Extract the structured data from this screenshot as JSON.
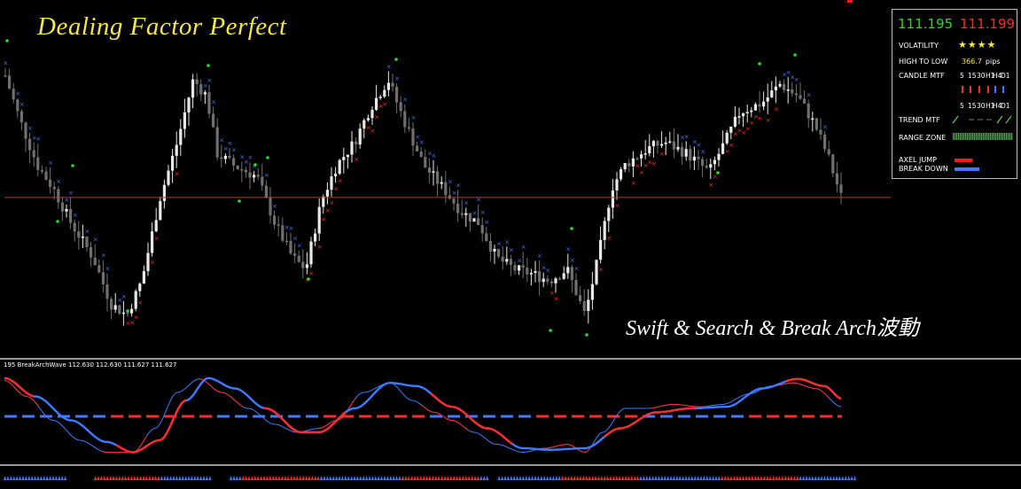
{
  "title": "Dealing Factor Perfect",
  "subtitle": "Swift & Search & Break Arch波動",
  "indicator_label": "195  BreakArchWave 112.630 112.630 111.627 111.627",
  "panel": {
    "bid": "111.195",
    "ask": "111.199",
    "volatility_label": "VOLATILITY",
    "volatility_stars": "★★★★",
    "high_low_label": "HIGH TO LOW",
    "high_low_value": "366.7",
    "high_low_unit": "pips",
    "candle_mtf_label": "CANDLE MTF",
    "timeframes": [
      "5",
      "15",
      "30",
      "H1",
      "H4",
      "D1"
    ],
    "candle_colors": [
      "#ff2a2a",
      "#ff2a2a",
      "#ff2a2a",
      "#ff2a2a",
      "#3e7bff",
      "#3e7bff"
    ],
    "trend_mtf_label": "TREND MTF",
    "range_zone_label": "RANGE ZONE",
    "axel_jump_label": "AXEL JUMP",
    "break_down_label": "BREAK DOWN"
  },
  "colors": {
    "background": "#000000",
    "title": "#f5e642",
    "bull_candle": "#e8e8e8",
    "bear_candle": "#6f6f6f",
    "up_marker": "#ff2a2a",
    "down_marker": "#3e7bff",
    "green_dot": "#22dd22",
    "horizontal_line": "#c0392b"
  },
  "chart_data": {
    "type": "candlestick",
    "price_path": [
      [
        0,
        112.4
      ],
      [
        5,
        112.35
      ],
      [
        22,
        112.15
      ],
      [
        42,
        111.95
      ],
      [
        60,
        111.85
      ],
      [
        80,
        111.7
      ],
      [
        105,
        111.55
      ],
      [
        125,
        111.35
      ],
      [
        143,
        111.3
      ],
      [
        160,
        111.45
      ],
      [
        180,
        111.8
      ],
      [
        200,
        112.05
      ],
      [
        218,
        112.32
      ],
      [
        233,
        112.25
      ],
      [
        245,
        112.0
      ],
      [
        263,
        111.95
      ],
      [
        290,
        111.9
      ],
      [
        310,
        111.7
      ],
      [
        330,
        111.55
      ],
      [
        345,
        111.5
      ],
      [
        363,
        111.8
      ],
      [
        380,
        111.95
      ],
      [
        400,
        112.05
      ],
      [
        418,
        112.2
      ],
      [
        438,
        112.32
      ],
      [
        455,
        112.15
      ],
      [
        478,
        111.95
      ],
      [
        500,
        111.85
      ],
      [
        520,
        111.75
      ],
      [
        540,
        111.7
      ],
      [
        560,
        111.55
      ],
      [
        580,
        111.5
      ],
      [
        600,
        111.48
      ],
      [
        620,
        111.45
      ],
      [
        640,
        111.5
      ],
      [
        660,
        111.3
      ],
      [
        675,
        111.55
      ],
      [
        690,
        111.85
      ],
      [
        705,
        111.95
      ],
      [
        730,
        112.02
      ],
      [
        750,
        112.05
      ],
      [
        775,
        112.0
      ],
      [
        800,
        111.92
      ],
      [
        818,
        112.05
      ],
      [
        835,
        112.18
      ],
      [
        860,
        112.22
      ],
      [
        880,
        112.3
      ],
      [
        900,
        112.25
      ],
      [
        920,
        112.12
      ],
      [
        935,
        111.98
      ],
      [
        950,
        111.8
      ]
    ],
    "reference_price": 111.81,
    "wave_fast": [
      [
        5,
        0.95
      ],
      [
        30,
        0.75
      ],
      [
        60,
        0.45
      ],
      [
        90,
        0.2
      ],
      [
        120,
        0.05
      ],
      [
        150,
        0.05
      ],
      [
        175,
        0.35
      ],
      [
        200,
        0.8
      ],
      [
        225,
        0.97
      ],
      [
        250,
        0.8
      ],
      [
        280,
        0.6
      ],
      [
        310,
        0.4
      ],
      [
        335,
        0.3
      ],
      [
        360,
        0.35
      ],
      [
        380,
        0.45
      ],
      [
        410,
        0.8
      ],
      [
        440,
        0.92
      ],
      [
        465,
        0.7
      ],
      [
        490,
        0.55
      ],
      [
        510,
        0.45
      ],
      [
        535,
        0.3
      ],
      [
        560,
        0.15
      ],
      [
        590,
        0.05
      ],
      [
        615,
        0.1
      ],
      [
        640,
        0.15
      ],
      [
        660,
        0.05
      ],
      [
        680,
        0.3
      ],
      [
        705,
        0.6
      ],
      [
        730,
        0.6
      ],
      [
        760,
        0.65
      ],
      [
        790,
        0.62
      ],
      [
        815,
        0.65
      ],
      [
        845,
        0.78
      ],
      [
        870,
        0.88
      ],
      [
        895,
        0.92
      ],
      [
        920,
        0.85
      ],
      [
        950,
        0.62
      ]
    ],
    "wave_slow": [
      [
        5,
        0.98
      ],
      [
        40,
        0.75
      ],
      [
        80,
        0.45
      ],
      [
        120,
        0.18
      ],
      [
        150,
        0.05
      ],
      [
        180,
        0.2
      ],
      [
        210,
        0.7
      ],
      [
        235,
        0.98
      ],
      [
        265,
        0.85
      ],
      [
        300,
        0.6
      ],
      [
        340,
        0.3
      ],
      [
        360,
        0.3
      ],
      [
        400,
        0.6
      ],
      [
        440,
        0.92
      ],
      [
        470,
        0.88
      ],
      [
        510,
        0.62
      ],
      [
        550,
        0.35
      ],
      [
        590,
        0.1
      ],
      [
        620,
        0.08
      ],
      [
        660,
        0.1
      ],
      [
        700,
        0.35
      ],
      [
        740,
        0.55
      ],
      [
        780,
        0.6
      ],
      [
        820,
        0.62
      ],
      [
        860,
        0.85
      ],
      [
        900,
        0.97
      ],
      [
        930,
        0.88
      ],
      [
        950,
        0.72
      ]
    ],
    "wave_zero": 0.5
  }
}
